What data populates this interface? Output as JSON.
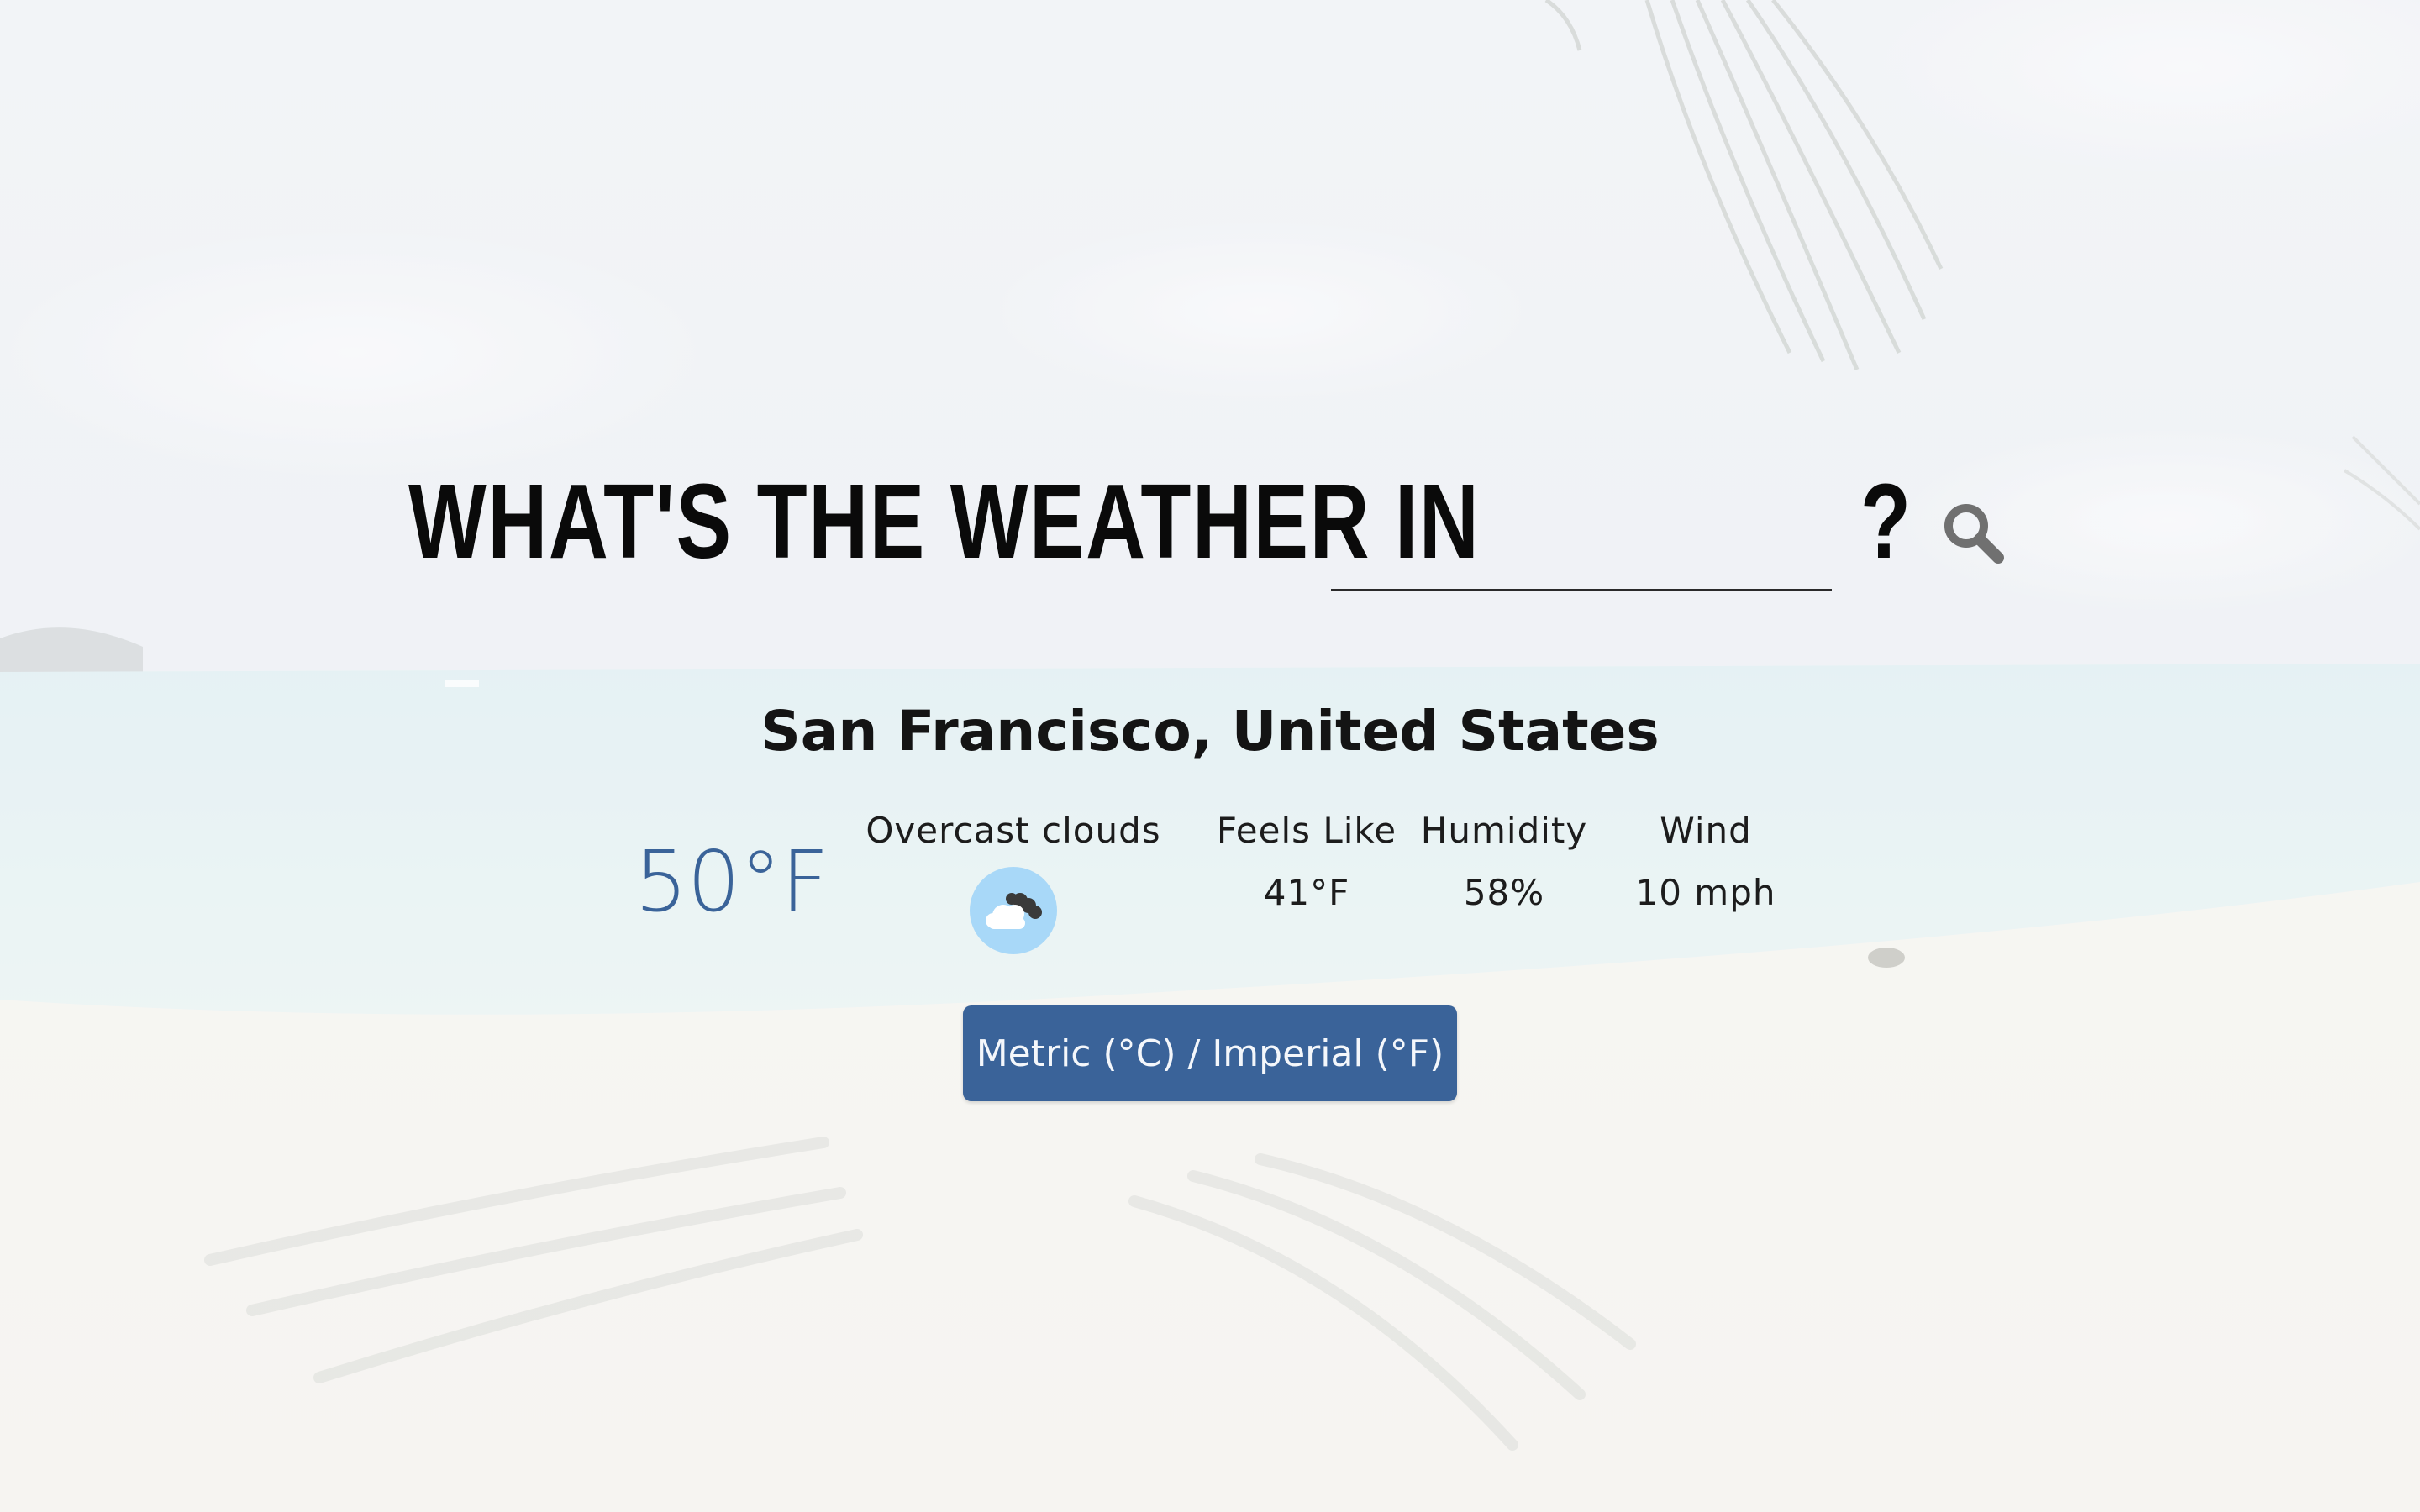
{
  "background": {
    "scene": "beach-palm-background"
  },
  "search": {
    "headline": "WHAT'S THE WEATHER IN",
    "input_value": "",
    "question_mark": "?",
    "button_icon": "search-icon"
  },
  "weather": {
    "location": "San Francisco, United States",
    "temperature": "50°F",
    "condition_label": "Overcast clouds",
    "condition_icon": "overcast-clouds-icon",
    "feels_like_label": "Feels Like",
    "feels_like_value": "41°F",
    "humidity_label": "Humidity",
    "humidity_value": "58%",
    "wind_label": "Wind",
    "wind_value": "10 mph"
  },
  "units_toggle": {
    "label": "Metric (°C) / Imperial (°F)"
  },
  "colors": {
    "accent": "#3a6399",
    "icon_circle": "#a8d8f8",
    "search_icon": "#707070"
  }
}
